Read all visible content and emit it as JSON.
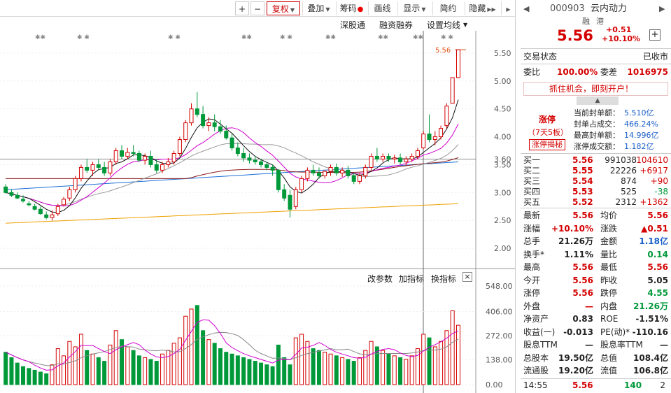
{
  "toolbar": {
    "plus": "+",
    "minus": "−",
    "fuquan": "复权",
    "diejia": "叠加",
    "chouma": "筹码",
    "huaxian": "画线",
    "xianshi": "显示",
    "jianyue": "简约",
    "yincang": "隐藏"
  },
  "subtoolbar": {
    "shengutong": "深股通",
    "rongzi": "融资融券",
    "junxian": "设置均线"
  },
  "price_axis": [
    "5.50",
    "5.00",
    "4.50",
    "4.00",
    "3.60",
    "3.50",
    "3.00",
    "2.50",
    "2.00"
  ],
  "price_marker": "5.56",
  "volume_header": {
    "gaican": "改参数",
    "jiazhi": "加指标",
    "huanzhi": "换指标",
    "close": "×"
  },
  "volume_axis": [
    "548.00",
    "406.00",
    "272.00",
    "138.00",
    "0.00"
  ],
  "chart_data": {
    "type": "candlestick",
    "ylim": [
      1.7,
      5.8
    ],
    "candles": [
      [
        3.1,
        3.15,
        3.0,
        2.98
      ],
      [
        3.0,
        3.05,
        2.95,
        2.92
      ],
      [
        2.95,
        3.0,
        2.9,
        2.88
      ],
      [
        2.88,
        2.95,
        2.85,
        2.82
      ],
      [
        2.8,
        2.85,
        2.78,
        2.75
      ],
      [
        2.75,
        2.8,
        2.7,
        2.68
      ],
      [
        2.7,
        2.75,
        2.62,
        2.6
      ],
      [
        2.6,
        2.66,
        2.55,
        2.52
      ],
      [
        2.55,
        2.68,
        2.6,
        2.5
      ],
      [
        2.62,
        2.8,
        2.75,
        2.58
      ],
      [
        2.78,
        2.92,
        2.88,
        2.75
      ],
      [
        2.9,
        3.1,
        3.05,
        2.85
      ],
      [
        3.05,
        3.3,
        3.25,
        3.0
      ],
      [
        3.25,
        3.5,
        3.45,
        3.2
      ],
      [
        3.45,
        3.6,
        3.4,
        3.35
      ],
      [
        3.4,
        3.55,
        3.5,
        3.3
      ],
      [
        3.5,
        3.6,
        3.45,
        3.4
      ],
      [
        3.45,
        3.55,
        3.35,
        3.3
      ],
      [
        3.35,
        3.6,
        3.55,
        3.3
      ],
      [
        3.55,
        3.8,
        3.75,
        3.5
      ],
      [
        3.75,
        3.85,
        3.65,
        3.6
      ],
      [
        3.65,
        3.8,
        3.72,
        3.6
      ],
      [
        3.72,
        3.85,
        3.7,
        3.65
      ],
      [
        3.7,
        3.75,
        3.58,
        3.55
      ],
      [
        3.58,
        3.7,
        3.65,
        3.5
      ],
      [
        3.65,
        3.75,
        3.5,
        3.45
      ],
      [
        3.5,
        3.6,
        3.4,
        3.35
      ],
      [
        3.4,
        3.55,
        3.5,
        3.35
      ],
      [
        3.5,
        3.62,
        3.55,
        3.45
      ],
      [
        3.55,
        3.75,
        3.7,
        3.5
      ],
      [
        3.7,
        4.0,
        3.95,
        3.65
      ],
      [
        3.95,
        4.3,
        4.25,
        3.9
      ],
      [
        4.25,
        4.6,
        4.5,
        4.2
      ],
      [
        4.5,
        4.8,
        4.4,
        4.35
      ],
      [
        4.4,
        4.55,
        4.2,
        4.15
      ],
      [
        4.2,
        4.35,
        4.25,
        4.1
      ],
      [
        4.25,
        4.4,
        4.18,
        4.1
      ],
      [
        4.18,
        4.3,
        4.1,
        4.05
      ],
      [
        4.1,
        4.2,
        3.98,
        3.95
      ],
      [
        3.98,
        4.05,
        3.8,
        3.75
      ],
      [
        3.8,
        3.9,
        3.7,
        3.65
      ],
      [
        3.7,
        3.8,
        3.62,
        3.55
      ],
      [
        3.62,
        3.7,
        3.58,
        3.52
      ],
      [
        3.58,
        3.65,
        3.55,
        3.5
      ],
      [
        3.55,
        3.6,
        3.5,
        3.45
      ],
      [
        3.5,
        3.55,
        3.45,
        3.4
      ],
      [
        3.45,
        3.5,
        3.4,
        3.3
      ],
      [
        3.4,
        3.42,
        3.05,
        3.0
      ],
      [
        3.05,
        3.15,
        2.9,
        2.85
      ],
      [
        2.95,
        3.05,
        2.7,
        2.55
      ],
      [
        2.75,
        3.1,
        3.05,
        2.7
      ],
      [
        3.05,
        3.3,
        3.25,
        3.0
      ],
      [
        3.25,
        3.45,
        3.4,
        3.2
      ],
      [
        3.4,
        3.5,
        3.35,
        3.3
      ],
      [
        3.35,
        3.45,
        3.3,
        3.25
      ],
      [
        3.3,
        3.4,
        3.38,
        3.25
      ],
      [
        3.38,
        3.5,
        3.45,
        3.3
      ],
      [
        3.45,
        3.52,
        3.35,
        3.3
      ],
      [
        3.35,
        3.45,
        3.4,
        3.28
      ],
      [
        3.4,
        3.48,
        3.3,
        3.25
      ],
      [
        3.3,
        3.35,
        3.2,
        3.15
      ],
      [
        3.2,
        3.35,
        3.3,
        3.15
      ],
      [
        3.3,
        3.5,
        3.45,
        3.25
      ],
      [
        3.45,
        3.7,
        3.65,
        3.4
      ],
      [
        3.65,
        3.8,
        3.6,
        3.55
      ],
      [
        3.6,
        3.7,
        3.65,
        3.55
      ],
      [
        3.65,
        3.7,
        3.6,
        3.55
      ],
      [
        3.6,
        3.68,
        3.62,
        3.52
      ],
      [
        3.62,
        3.7,
        3.55,
        3.5
      ],
      [
        3.55,
        3.65,
        3.6,
        3.48
      ],
      [
        3.6,
        3.7,
        3.65,
        3.55
      ],
      [
        3.65,
        3.8,
        3.75,
        3.6
      ],
      [
        3.8,
        4.1,
        4.05,
        3.78
      ],
      [
        4.05,
        4.4,
        3.95,
        3.9
      ],
      [
        3.95,
        4.1,
        4.0,
        3.85
      ],
      [
        4.0,
        4.2,
        4.15,
        3.95
      ],
      [
        4.2,
        4.6,
        4.55,
        4.15
      ],
      [
        4.6,
        5.06,
        5.06,
        4.6
      ],
      [
        5.06,
        5.56,
        5.56,
        5.06
      ]
    ],
    "volumes": [
      180,
      150,
      120,
      100,
      90,
      80,
      70,
      60,
      110,
      200,
      160,
      240,
      210,
      280,
      190,
      170,
      150,
      130,
      220,
      300,
      250,
      210,
      190,
      160,
      150,
      140,
      130,
      170,
      190,
      230,
      260,
      380,
      420,
      440,
      300,
      250,
      230,
      200,
      180,
      170,
      160,
      150,
      140,
      130,
      120,
      110,
      100,
      220,
      150,
      110,
      260,
      280,
      240,
      200,
      190,
      180,
      170,
      160,
      150,
      140,
      130,
      150,
      190,
      240,
      210,
      190,
      170,
      160,
      150,
      140,
      160,
      200,
      280,
      260,
      210,
      240,
      300,
      410,
      330
    ]
  },
  "sidebar": {
    "code": "000903",
    "name": "云内动力",
    "tag_rong": "融",
    "tag_gang": "港",
    "price": "5.56",
    "change": "+0.51",
    "pct": "+10.10%",
    "trade_status_label": "交易状态",
    "trade_status": "已收市",
    "weibi_label": "委比",
    "weibi": "100.00%",
    "weicha_label": "委差",
    "weicha": "1016975",
    "promo": "抓住机会，即刻开户！",
    "zhangting": "涨停",
    "days": "（7天5板）",
    "secret": "涨停揭秘",
    "fd_label1": "当前封单额：",
    "fd_val1": "5.510亿",
    "fd_label2": "封单占成交：",
    "fd_val2": "466.24%",
    "fd_label3": "最高封单额：",
    "fd_val3": "14.996亿",
    "fd_label4": "涨停成交额：",
    "fd_val4": "1.182亿",
    "bids": [
      {
        "label": "买一",
        "price": "5.56",
        "vol": "991038",
        "chg": "104610"
      },
      {
        "label": "买二",
        "price": "5.55",
        "vol": "22226",
        "chg": "+6917"
      },
      {
        "label": "买三",
        "price": "5.54",
        "vol": "874",
        "chg": "+90"
      },
      {
        "label": "买四",
        "price": "5.53",
        "vol": "525",
        "chg": "-38"
      },
      {
        "label": "买五",
        "price": "5.52",
        "vol": "2312",
        "chg": "+1362"
      }
    ],
    "stats": [
      {
        "l1": "最新",
        "v1": "5.56",
        "c1": "red",
        "l2": "均价",
        "v2": "5.56",
        "c2": "red"
      },
      {
        "l1": "涨幅",
        "v1": "+10.10%",
        "c1": "red",
        "l2": "涨跌",
        "v2": "▲0.51",
        "c2": "red"
      },
      {
        "l1": "总手",
        "v1": "21.26万",
        "c1": "",
        "l2": "金额",
        "v2": "1.18亿",
        "c2": "blue"
      },
      {
        "l1": "换手*",
        "v1": "1.11%",
        "c1": "",
        "l2": "量比",
        "v2": "0.14",
        "c2": "green"
      },
      {
        "l1": "最高",
        "v1": "5.56",
        "c1": "red",
        "l2": "最低",
        "v2": "5.56",
        "c2": "red"
      },
      {
        "l1": "今开",
        "v1": "5.56",
        "c1": "red",
        "l2": "昨收",
        "v2": "5.05",
        "c2": ""
      },
      {
        "l1": "涨停",
        "v1": "5.56",
        "c1": "red",
        "l2": "跌停",
        "v2": "4.55",
        "c2": "green"
      },
      {
        "l1": "外盘",
        "v1": "—",
        "c1": "red",
        "l2": "内盘",
        "v2": "21.26万",
        "c2": "green"
      },
      {
        "l1": "净资产",
        "v1": "0.83",
        "c1": "",
        "l2": "ROE",
        "v2": "-1.51%",
        "c2": ""
      },
      {
        "l1": "收益(一)",
        "v1": "-0.013",
        "c1": "",
        "l2": "PE(动)*",
        "v2": "-110.16",
        "c2": ""
      },
      {
        "l1": "股息TTM",
        "v1": "—",
        "c1": "",
        "l2": "股息率TTM",
        "v2": "—",
        "c2": ""
      },
      {
        "l1": "总股本",
        "v1": "19.50亿",
        "c1": "",
        "l2": "总值",
        "v2": "108.4亿",
        "c2": ""
      },
      {
        "l1": "流通股",
        "v1": "19.20亿",
        "c1": "",
        "l2": "流值",
        "v2": "106.8亿",
        "c2": ""
      }
    ],
    "tick": {
      "time": "14:55",
      "price": "5.56",
      "vol": "140",
      "num": "2"
    }
  },
  "colors": {
    "up": "#d40000",
    "down": "#00993a",
    "ma5": "#111111",
    "ma10": "#d200d2",
    "ma20": "#999999",
    "ma60": "#8b1a1a",
    "ma120": "#1a6fd8",
    "ma250": "#f0a000"
  }
}
